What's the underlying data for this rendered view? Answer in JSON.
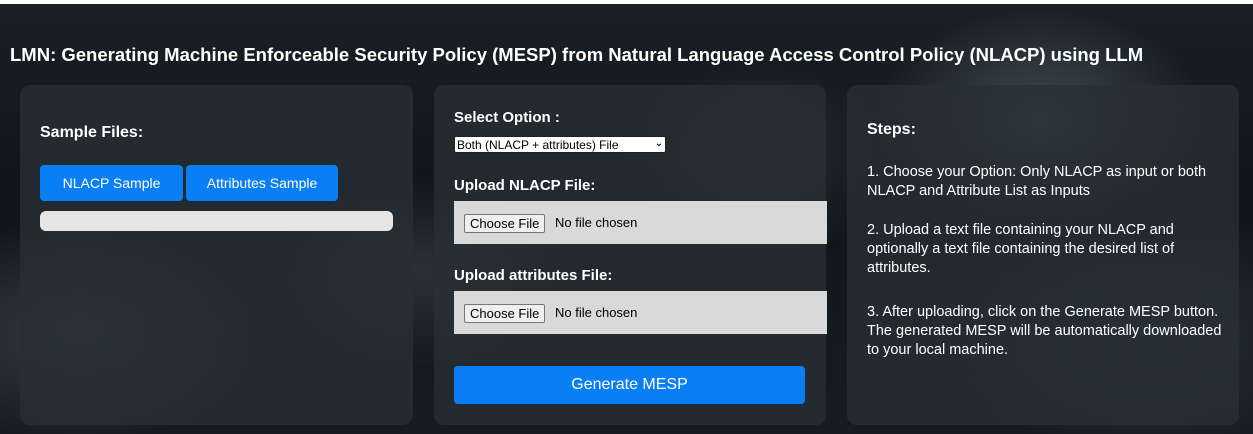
{
  "header": {
    "title": "LMN: Generating Machine Enforceable Security Policy (MESP) from Natural Language Access Control Policy (NLACP) using LLM"
  },
  "sample_panel": {
    "heading": "Sample Files:",
    "nlacp_button": "NLACP Sample",
    "attributes_button": "Attributes Sample",
    "progress_percent": 0
  },
  "upload_panel": {
    "select_label": "Select Option :",
    "select_value": "Both (NLACP + attributes) File",
    "nlacp_label": "Upload NLACP File:",
    "attributes_label": "Upload attributes File:",
    "choose_file_label": "Choose File",
    "no_file_text": "No file chosen",
    "generate_button": "Generate MESP"
  },
  "steps_panel": {
    "heading": "Steps:",
    "steps": [
      "1. Choose your Option: Only NLACP as input or both NLACP and Attribute List as Inputs",
      "2. Upload a text file containing your NLACP and optionally a text file containing the desired list of attributes.",
      "3. After uploading, click on the Generate MESP button. The generated MESP will be automatically downloaded to your local machine."
    ]
  },
  "colors": {
    "accent": "#0a7ff5",
    "panel_bg": "#283036",
    "text": "#ffffff"
  }
}
